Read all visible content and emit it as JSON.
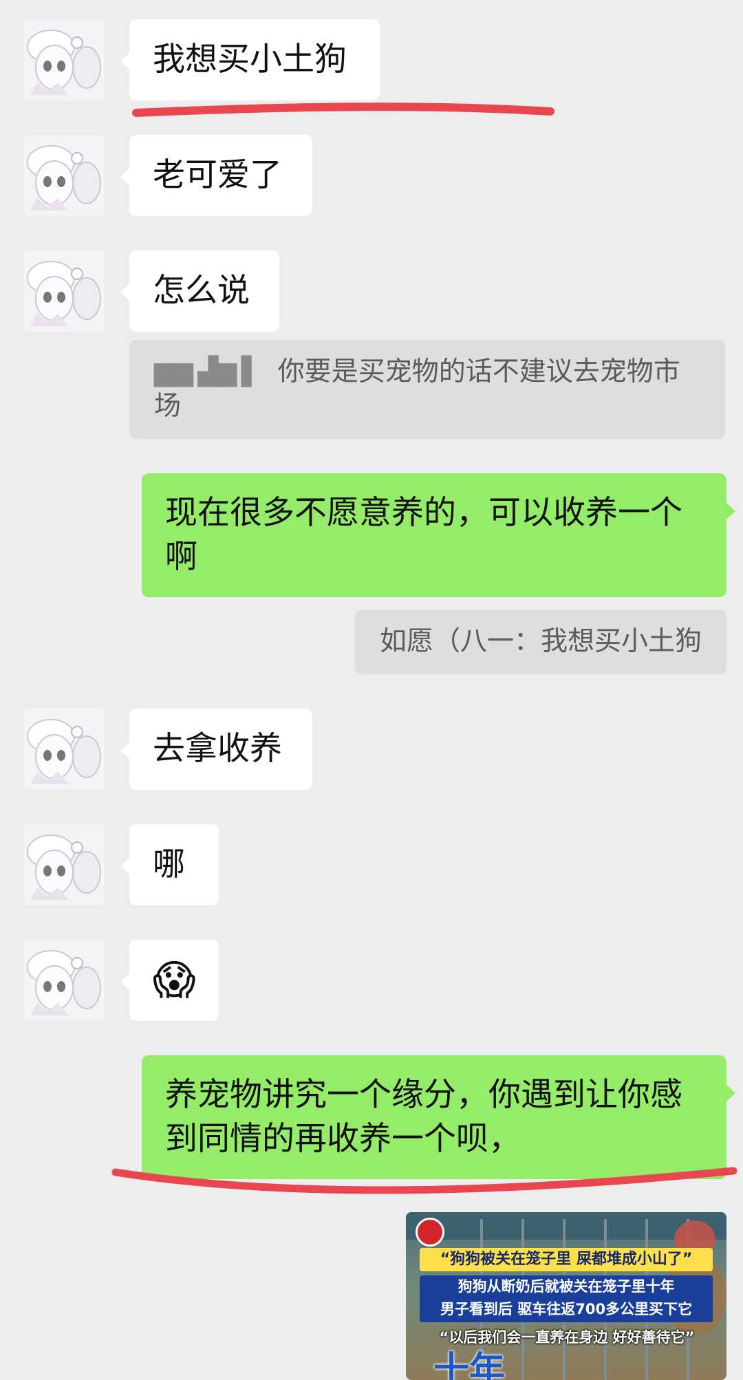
{
  "messages": {
    "m1": "我想买小土狗",
    "m2": "老可爱了",
    "m3": "怎么说",
    "q1_sender_masked": "▆▆ ▟▆ ▌",
    "q1_text": "你要是买宠物的话不建议去宠物市场",
    "m4": "现在很多不愿意养的，可以收养一个啊",
    "q2_text": "如愿（八一：我想买小土狗",
    "m5": "去拿收养",
    "m6": "哪",
    "m7_emoji": "😱",
    "m8": "养宠物讲究一个缘分，你遇到让你感到同情的再收养一个呗，",
    "video": {
      "headline": "“狗狗被关在笼子里 屎都堆成小山了”",
      "line1": "狗狗从断奶后就被关在笼子里十年",
      "line2": "男子看到后 驱车往返700多公里买下它",
      "quote": "“以后我们会一直养在身边 好好善待它”",
      "big": "十年"
    }
  },
  "colors": {
    "background": "#ededed",
    "incoming_bubble": "#ffffff",
    "outgoing_bubble": "#95ec69",
    "quote_bg": "#dedede",
    "annotation": "#e8474f"
  },
  "icons": {
    "avatar": "anime-girl-avatar",
    "emoji": "screaming-face"
  }
}
